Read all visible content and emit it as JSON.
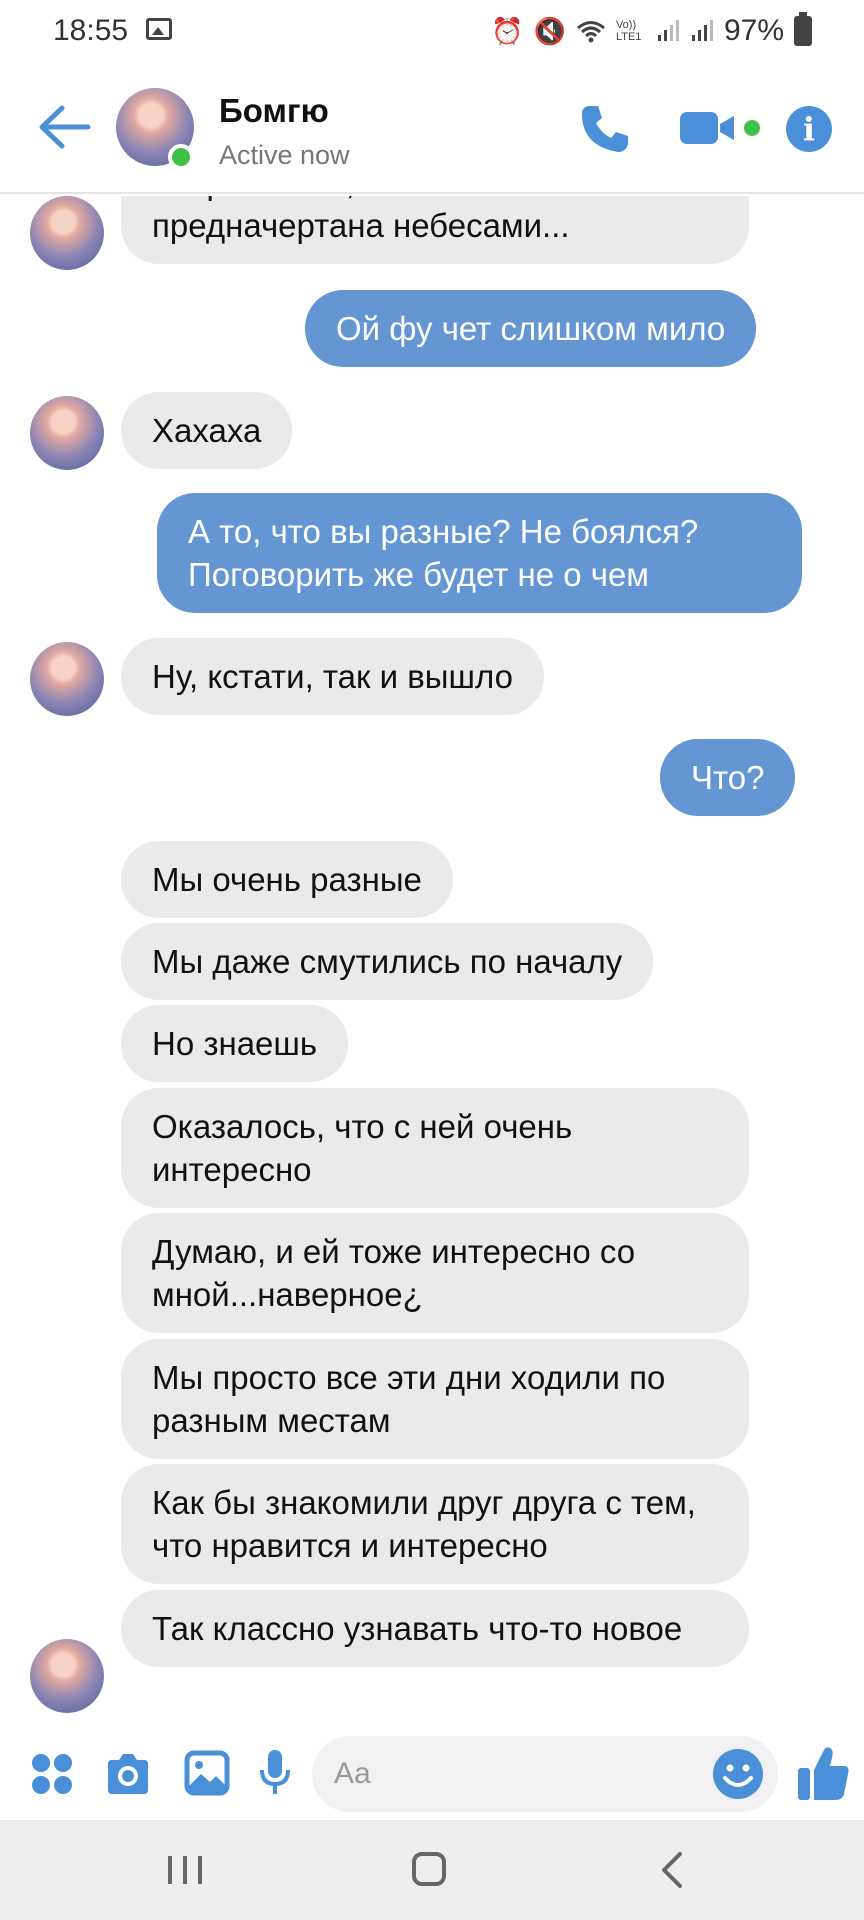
{
  "status_bar": {
    "time": "18:55",
    "battery": "97%",
    "signal_label": "Vo)) LTE1"
  },
  "header": {
    "name": "Бомгю",
    "status": "Active now"
  },
  "messages": [
    {
      "dir": "in",
      "text": "понравиться, если наша связь предначертана небесами..."
    },
    {
      "dir": "out",
      "text": "Ой фу чет слишком мило"
    },
    {
      "dir": "in",
      "text": "Хахаха"
    },
    {
      "dir": "out",
      "text": "А то, что вы разные? Не боялся? Поговорить же будет не о чем"
    },
    {
      "dir": "in",
      "text": "Ну, кстати, так и вышло"
    },
    {
      "dir": "out",
      "text": "Что?"
    },
    {
      "dir": "in",
      "text": "Мы очень разные"
    },
    {
      "dir": "in",
      "text": "Мы даже смутились по началу"
    },
    {
      "dir": "in",
      "text": "Но знаешь"
    },
    {
      "dir": "in",
      "text": "Оказалось, что с ней очень интересно"
    },
    {
      "dir": "in",
      "text": "Думаю, и ей тоже интересно со мной...наверное¿"
    },
    {
      "dir": "in",
      "text": "Мы просто все эти дни ходили по разным местам"
    },
    {
      "dir": "in",
      "text": "Как бы знакомили друг друга с тем, что нравится и интересно"
    },
    {
      "dir": "in",
      "text": "Так классно узнавать что-то новое"
    }
  ],
  "composer": {
    "placeholder": "Aa"
  },
  "colors": {
    "accent": "#4a90d9",
    "outgoing_bubble": "#6496d3",
    "incoming_bubble": "#ebe9ec",
    "online": "#40c046"
  },
  "icons": [
    "back-arrow-icon",
    "phone-icon",
    "video-camera-icon",
    "info-icon",
    "apps-icon",
    "camera-icon",
    "gallery-icon",
    "microphone-icon",
    "emoji-icon",
    "thumbs-up-icon"
  ]
}
